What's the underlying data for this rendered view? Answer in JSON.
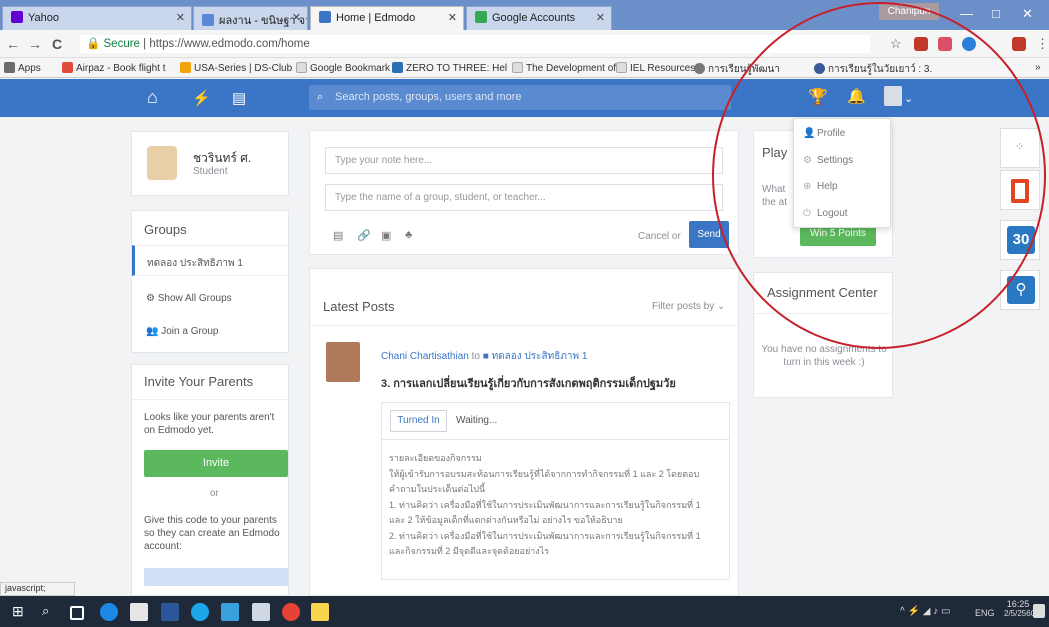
{
  "browser": {
    "tabs": [
      {
        "label": "Yahoo",
        "color": "#6001d2"
      },
      {
        "label": "ผลงาน - ขนิษฐา จาดี",
        "color": "#5b86d6"
      },
      {
        "label": "Home | Edmodo",
        "color": "#3b75c5"
      },
      {
        "label": "Google Accounts",
        "color": "#34a853"
      }
    ],
    "user_chip": "Chanipun",
    "window_controls": {
      "minimize": "—",
      "maximize": "□",
      "close": "✕"
    },
    "nav": {
      "back": "←",
      "forward": "→",
      "reload": "C"
    },
    "secure_label": "Secure",
    "url": "https://www.edmodo.com/home",
    "bookmarks": [
      {
        "label": "Apps",
        "color": "#6c6c6c"
      },
      {
        "label": "Airpaz - Book flight t",
        "color": "#e04b3a"
      },
      {
        "label": "USA-Series | DS-Club",
        "color": "#f0a30a"
      },
      {
        "label": "Google Bookmark",
        "color": "#cccccc"
      },
      {
        "label": "ZERO TO THREE: Hel",
        "color": "#2b6fb6"
      },
      {
        "label": "The Development of",
        "color": "#cccccc"
      },
      {
        "label": "IEL Resources",
        "color": "#cccccc"
      },
      {
        "label": "การเรียนรู้พัฒนา",
        "color": "#777777"
      },
      {
        "label": "การเรียนรู้ในวัยเยาว์ : 3.",
        "color": "#3b5998"
      }
    ],
    "more": "»",
    "status_text": "javascript;"
  },
  "edmodo": {
    "search_placeholder": "Search posts, groups, users and more",
    "profile": {
      "name": "ชวรินทร์ ศ.",
      "role": "Student"
    },
    "groups_title": "Groups",
    "group_name": "ทดลอง ประสิทธิภาพ 1",
    "show_all_groups": "Show All Groups",
    "join_group": "Join a Group",
    "invite_title": "Invite Your Parents",
    "invite_text": "Looks like your parents aren't on Edmodo yet.",
    "invite_button": "Invite",
    "or": "or",
    "code_text": "Give this code to your parents so they can create an Edmodo account:",
    "note_placeholder": "Type your note here...",
    "recipient_placeholder": "Type the name of a group, student, or teacher...",
    "cancel": "Cancel or",
    "send": "Send",
    "latest_posts": "Latest Posts",
    "filter_posts": "Filter posts by",
    "post": {
      "author": "Chani Chartisathian",
      "to": "to",
      "group": "ทดลอง ประสิทธิภาพ 1",
      "title": "3. การแลกเปลี่ยนเรียนรู้เกี่ยวกับการสังเกตพฤติกรรมเด็กปฐมวัย",
      "turned_in": "Turned In",
      "waiting": "Waiting...",
      "body": [
        "รายละเอียดของกิจกรรม",
        "ให้ผู้เข้ารับการอบรมสะท้อนการเรียนรู้ที่ได้จากการทำกิจกรรมที่ 1 และ 2 โดยตอบ",
        "คำถามในประเด็นต่อไปนี้",
        "1. ท่านคิดว่า เครื่องมือที่ใช้ในการประเมินพัฒนาการและการเรียนรู้ในกิจกรรมที่ 1",
        "และ 2 ให้ข้อมูลเด็กที่แตกต่างกันหรือไม่ อย่างไร ขอให้อธิบาย",
        "2. ท่านคิดว่า เครื่องมือที่ใช้ในการประเมินพัฒนาการและการเรียนรู้ในกิจกรรมที่ 1",
        "และกิจกรรมที่ 2 มีจุดดีและจุดด้อยอย่างไร"
      ]
    },
    "play_title": "Play",
    "play_text": "What the at",
    "win_points": "Win 5 Points",
    "assignment_title": "Assignment Center",
    "assignment_empty": "You have no assignments to turn in this week :)",
    "menu": {
      "profile": "Profile",
      "settings": "Settings",
      "help": "Help",
      "logout": "Logout"
    },
    "tool_30": "30"
  },
  "taskbar": {
    "time": "16:25",
    "date": "2/5/2560",
    "lang": "ENG"
  },
  "colors": {
    "brand": "#3b75c5",
    "green": "#5cb85c",
    "annotation": "#c8202b"
  }
}
